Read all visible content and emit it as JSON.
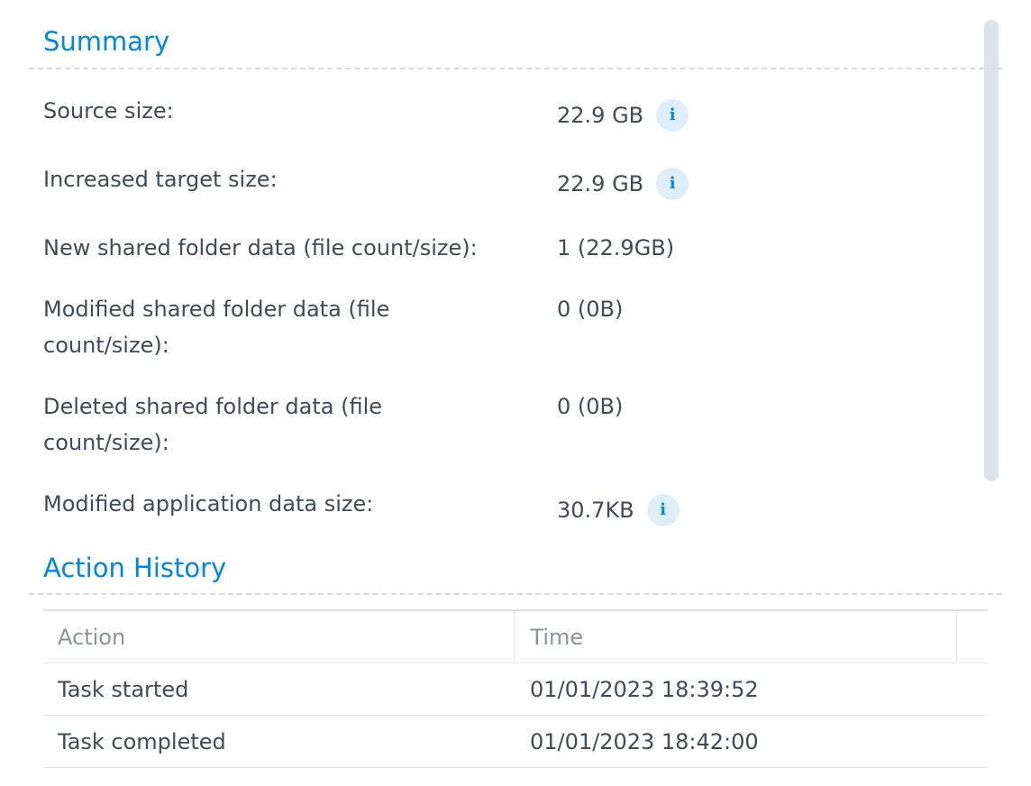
{
  "summary": {
    "title": "Summary",
    "rows": [
      {
        "label": "Source size:",
        "value": "22.9 GB",
        "has_info": true
      },
      {
        "label": "Increased target size:",
        "value": "22.9 GB",
        "has_info": true
      },
      {
        "label": "New shared folder data (file count/size):",
        "value": "1 (22.9GB)",
        "has_info": false
      },
      {
        "label": "Modified shared folder data (file count/size):",
        "value": "0 (0B)",
        "has_info": false
      },
      {
        "label": "Deleted shared folder data (file count/size):",
        "value": "0 (0B)",
        "has_info": false
      },
      {
        "label": "Modified application data size:",
        "value": "30.7KB",
        "has_info": true
      }
    ]
  },
  "info_icon": {
    "name": "info-icon",
    "glyph": "i"
  },
  "action_history": {
    "title": "Action History",
    "columns": [
      "Action",
      "Time"
    ],
    "rows": [
      {
        "action": "Task started",
        "time": "01/01/2023 18:39:52"
      },
      {
        "action": "Task completed",
        "time": "01/01/2023 18:42:00"
      }
    ]
  },
  "colors": {
    "accent": "#0086e5",
    "text": "#414b55",
    "muted": "#8b939a",
    "info_bg": "#dfeefb"
  }
}
